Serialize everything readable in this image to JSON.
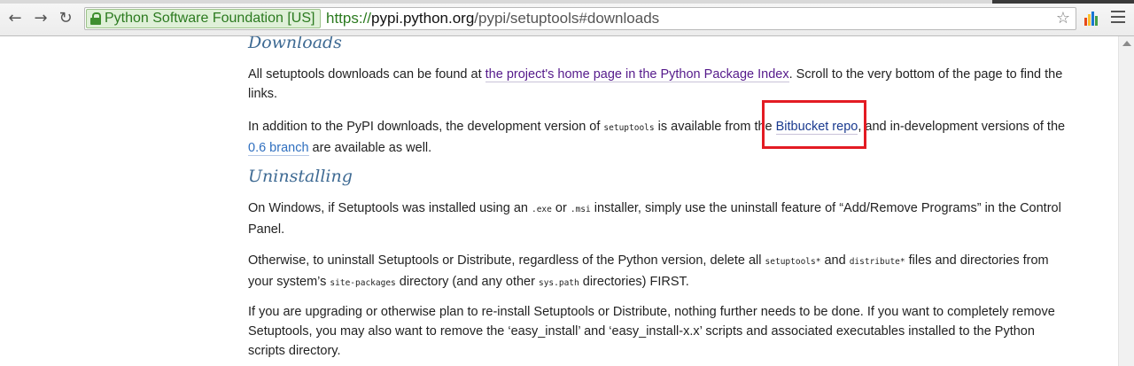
{
  "browser": {
    "ev_org": "Python Software Foundation [US]",
    "url_scheme": "https://",
    "url_host": "pypi.python.org",
    "url_path": "/pypi/setuptools#downloads"
  },
  "downloads": {
    "heading": "Downloads",
    "p1_prefix": "All setuptools downloads can be found at ",
    "p1_link": "the project's home page in the Python Package Index",
    "p1_suffix": ". Scroll to the very bottom of the page to find the links.",
    "p2_a": "In addition to the PyPI downloads, the development version of ",
    "p2_code": "setuptools",
    "p2_b": " is available from the ",
    "p2_link1": "Bitbucket repo",
    "p2_c": ", and in-development versions of the ",
    "p2_link2": "0.6 branch",
    "p2_d": " are available as well."
  },
  "uninstalling": {
    "heading": "Uninstalling",
    "p1_a": "On Windows, if Setuptools was installed using an ",
    "p1_code1": ".exe",
    "p1_b": " or ",
    "p1_code2": ".msi",
    "p1_c": " installer, simply use the uninstall feature of “Add/Remove Programs” in the Control Panel.",
    "p2_a": "Otherwise, to uninstall Setuptools or Distribute, regardless of the Python version, delete all ",
    "p2_code1": "setuptools*",
    "p2_b": " and ",
    "p2_code2": "distribute*",
    "p2_c": " files and directories from your system’s ",
    "p2_code3": "site-packages",
    "p2_d": " directory (and any other ",
    "p2_code4": "sys.path",
    "p2_e": " directories) FIRST.",
    "p3": "If you are upgrading or otherwise plan to re-install Setuptools or Distribute, nothing further needs to be done. If you want to completely remove Setuptools, you may also want to remove the ‘easy_install’ and ‘easy_install-x.x’ scripts and associated executables installed to the Python scripts directory."
  },
  "icons": {
    "back": "←",
    "forward": "→",
    "reload": "↻",
    "star": "☆"
  },
  "colors": {
    "heading": "#3e6a93",
    "highlight_box": "#e31b23",
    "ev_green": "#2b7a1f"
  }
}
